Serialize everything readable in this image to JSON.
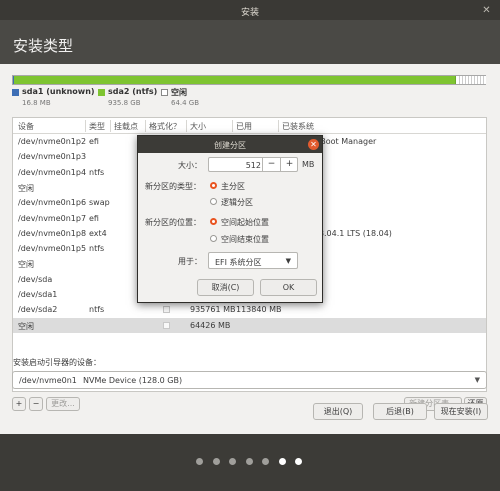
{
  "window": {
    "title": "安装",
    "close_icon": "close-icon"
  },
  "header": {
    "title": "安装类型"
  },
  "partition_bar": {
    "legend": [
      {
        "name": "sda1 (unknown)",
        "size": "16.8 MB",
        "color": "#3d6eb5"
      },
      {
        "name": "sda2 (ntfs)",
        "size": "935.8 GB",
        "color": "#7ec431"
      },
      {
        "name": "空闲",
        "size": "64.4 GB",
        "color": "#ffffff"
      }
    ]
  },
  "table": {
    "columns": [
      "设备",
      "类型",
      "挂载点",
      "格式化？",
      "大小",
      "已用",
      "已装系统"
    ],
    "rows": [
      {
        "device": "/dev/nvme0n1p2",
        "type": "efi",
        "size": "",
        "used": "",
        "system": "Windows Boot Manager",
        "checkbox": false
      },
      {
        "device": "/dev/nvme0n1p3",
        "type": "",
        "size": "",
        "used": "",
        "system": "",
        "checkbox": false
      },
      {
        "device": "/dev/nvme0n1p4",
        "type": "ntfs",
        "size": "",
        "used": "",
        "system": "",
        "checkbox": false
      },
      {
        "device": "空闲",
        "type": "",
        "size": "",
        "used": "",
        "system": "",
        "checkbox": false
      },
      {
        "device": "/dev/nvme0n1p6",
        "type": "swap",
        "size": "",
        "used": "",
        "system": "",
        "checkbox": false
      },
      {
        "device": "/dev/nvme0n1p7",
        "type": "efi",
        "size": "",
        "used": "",
        "system": "",
        "checkbox": false
      },
      {
        "device": "/dev/nvme0n1p8",
        "type": "ext4",
        "size": "",
        "used": "",
        "system": "Ubuntu 18.04.1 LTS (18.04)",
        "checkbox": false
      },
      {
        "device": "/dev/nvme0n1p5",
        "type": "ntfs",
        "size": "",
        "used": "",
        "system": "",
        "checkbox": false
      },
      {
        "device": "空闲",
        "type": "",
        "size": "",
        "used": "",
        "system": "",
        "checkbox": false
      },
      {
        "device": "/dev/sda",
        "type": "",
        "size": "",
        "used": "",
        "system": "",
        "checkbox": false
      },
      {
        "device": "/dev/sda1",
        "type": "",
        "size": "",
        "used": "",
        "system": "",
        "checkbox": false
      },
      {
        "device": "/dev/sda2",
        "type": "ntfs",
        "size": "935761 MB",
        "used": "113840 MB",
        "system": "",
        "checkbox": true
      },
      {
        "device": "空闲",
        "type": "",
        "size": "64426 MB",
        "used": "",
        "system": "",
        "checkbox": true,
        "selected": true
      }
    ]
  },
  "table_buttons": {
    "add": "+",
    "remove": "−",
    "change": "更改...",
    "new_table": "新建分区表...",
    "revert": "还原"
  },
  "boot_loader": {
    "label": "安装启动引导器的设备：",
    "device": "/dev/nvme0n1",
    "description": "NVMe Device (128.0 GB)"
  },
  "nav_buttons": {
    "quit": "退出(Q)",
    "back": "后退(B)",
    "install_now": "现在安装(I)"
  },
  "progress_dots": {
    "total": 7,
    "active": [
      5,
      6
    ]
  },
  "dialog": {
    "title": "创建分区",
    "size_label": "大小：",
    "size_value": "512",
    "size_unit": "MB",
    "type_label": "新分区的类型：",
    "type_primary": "主分区",
    "type_logical": "逻辑分区",
    "type_selected": "主分区",
    "location_label": "新分区的位置：",
    "location_start": "空间起始位置",
    "location_end": "空间结束位置",
    "location_selected": "空间起始位置",
    "use_label": "用于：",
    "use_value": "EFI 系统分区",
    "cancel": "取消(C)",
    "ok": "OK",
    "accent": "#e95420"
  }
}
